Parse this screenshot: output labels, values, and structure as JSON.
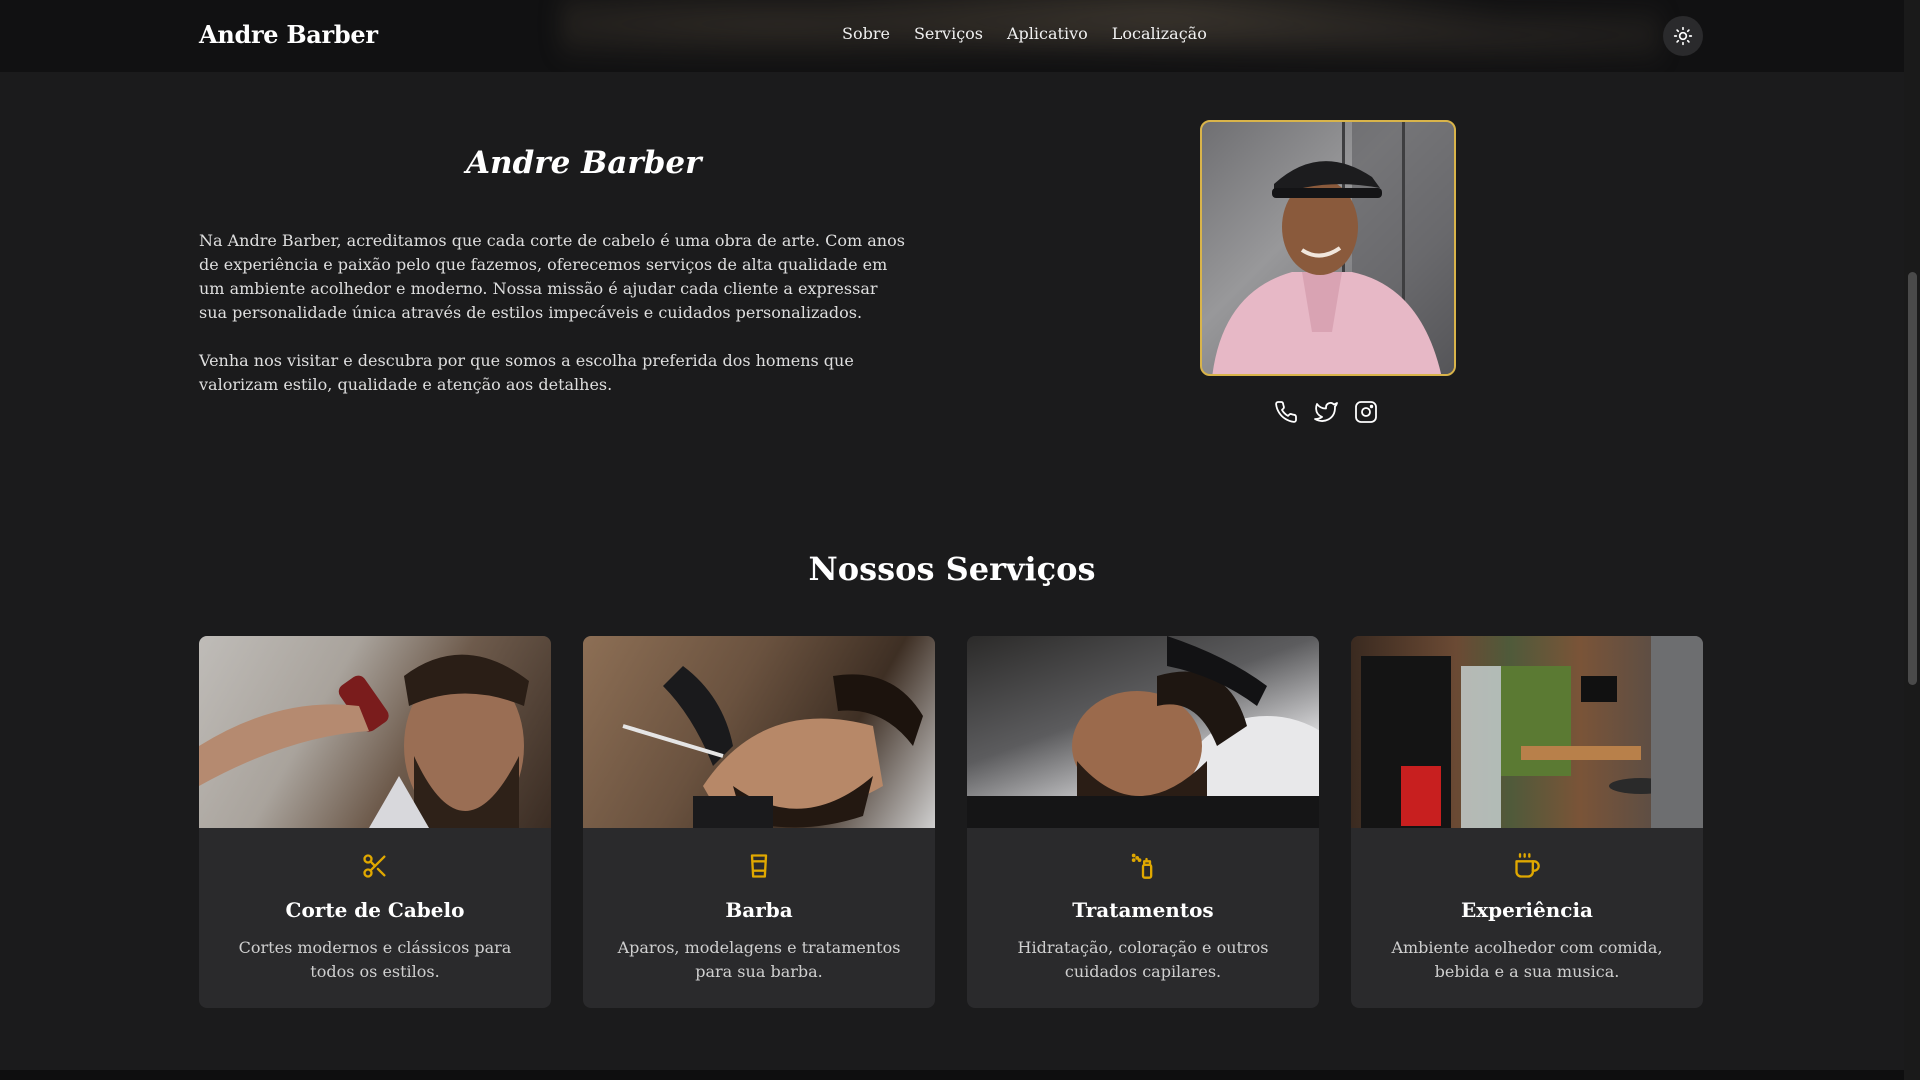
{
  "navbar": {
    "brand": "Andre Barber",
    "links": [
      "Sobre",
      "Serviços",
      "Aplicativo",
      "Localização"
    ],
    "theme_icon": "sun-icon"
  },
  "about": {
    "title": "Andre Barber",
    "paragraphs": [
      "Na Andre Barber, acreditamos que cada corte de cabelo é uma obra de arte. Com anos de experiência e paixão pelo que fazemos, oferecemos serviços de alta qualidade em um ambiente acolhedor e moderno. Nossa missão é ajudar cada cliente a expressar sua personalidade única através de estilos impecáveis e cuidados personalizados.",
      "Venha nos visitar e descubra por que somos a escolha preferida dos homens que valorizam estilo, qualidade e atenção aos detalhes."
    ],
    "portrait_accent": "#d9b44a",
    "social_icons": [
      "phone-icon",
      "twitter-icon",
      "instagram-icon"
    ]
  },
  "services": {
    "title": "Nossos Serviços",
    "accent": "#e0a800",
    "cards": [
      {
        "title": "Corte de Cabelo",
        "desc": "Cortes modernos e clássicos para todos os estilos.",
        "icon": "scissors-icon"
      },
      {
        "title": "Barba",
        "desc": "Aparos, modelagens e tratamentos para sua barba.",
        "icon": "beard-care-icon"
      },
      {
        "title": "Tratamentos",
        "desc": "Hidratação, coloração e outros cuidados capilares.",
        "icon": "spray-bottle-icon"
      },
      {
        "title": "Experiência",
        "desc": "Ambiente acolhedor com comida, bebida e a sua musica.",
        "icon": "coffee-icon"
      }
    ]
  }
}
